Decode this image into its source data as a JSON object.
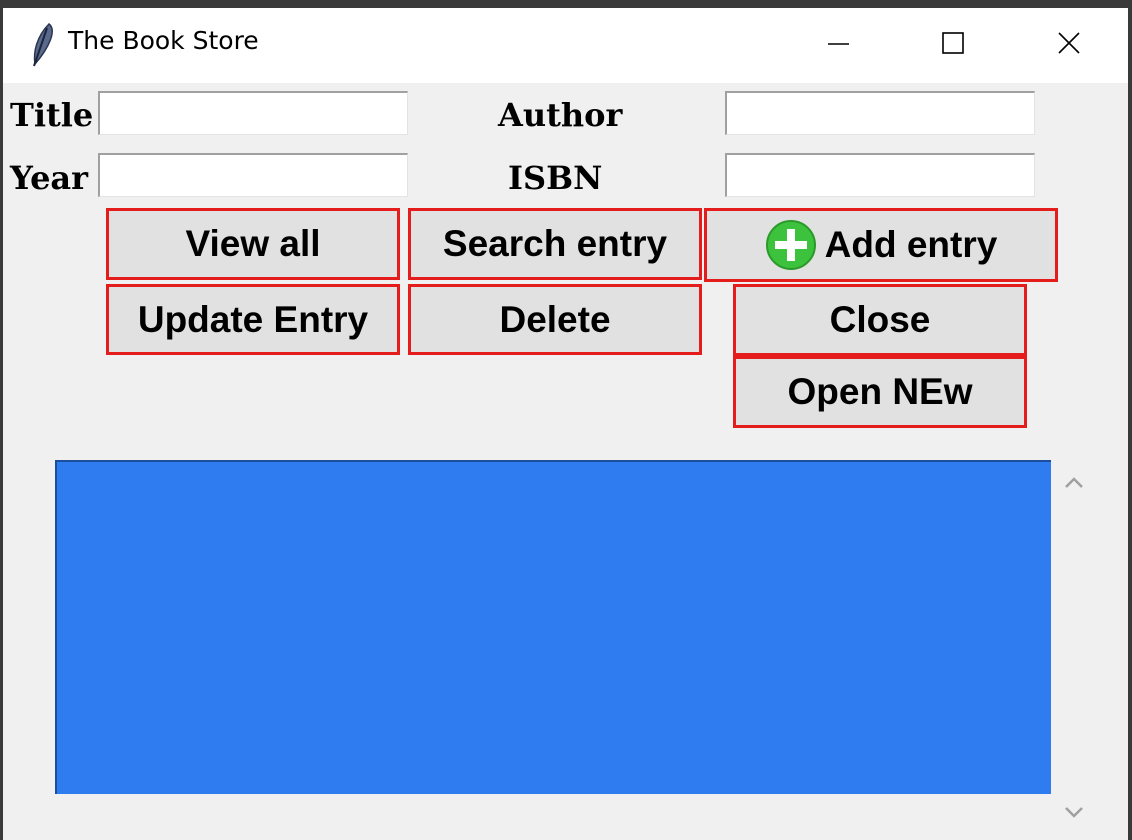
{
  "window": {
    "title": "The Book Store",
    "icons": {
      "app": "feather-icon",
      "minimize": "minimize-icon",
      "maximize": "maximize-icon",
      "close": "close-icon"
    }
  },
  "form": {
    "title_label": "Title",
    "author_label": "Author",
    "year_label": "Year",
    "isbn_label": "ISBN",
    "title_value": "",
    "author_value": "",
    "year_value": "",
    "isbn_value": ""
  },
  "buttons": {
    "view_all": "View all",
    "search_entry": "Search entry",
    "add_entry": "Add entry",
    "update_entry": "Update Entry",
    "delete": "Delete",
    "close": "Close",
    "open_new": "Open NEw"
  },
  "colors": {
    "button_border": "#e51c1c",
    "listbox_background": "#2f7bf0",
    "add_icon": "#3cc23c"
  },
  "listbox": {
    "items": []
  },
  "scrollbar": {
    "up_icon": "chevron-up-icon",
    "down_icon": "chevron-down-icon"
  }
}
